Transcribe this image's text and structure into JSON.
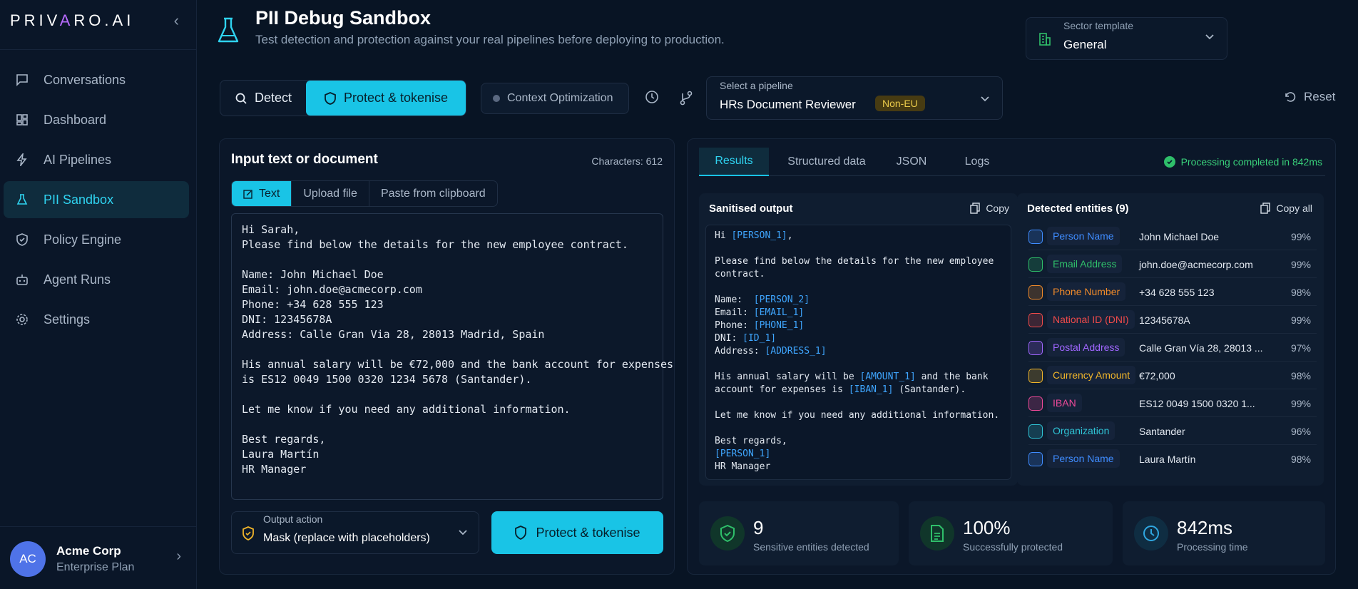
{
  "app": {
    "logo_left": "PRIV",
    "logo_a": "A",
    "logo_right": "RO.AI"
  },
  "sidebar": {
    "items": [
      {
        "label": "Conversations",
        "icon": "chat-icon"
      },
      {
        "label": "Dashboard",
        "icon": "dashboard-icon"
      },
      {
        "label": "AI Pipelines",
        "icon": "bolt-icon"
      },
      {
        "label": "PII Sandbox",
        "icon": "flask-icon",
        "active": true
      },
      {
        "label": "Policy Engine",
        "icon": "shield-icon"
      },
      {
        "label": "Agent Runs",
        "icon": "robot-icon"
      },
      {
        "label": "Settings",
        "icon": "gear-icon"
      }
    ],
    "account": {
      "initials": "AC",
      "name": "Acme Corp",
      "plan": "Enterprise Plan"
    }
  },
  "header": {
    "title": "PII Debug Sandbox",
    "subtitle": "Test detection and protection against your real pipelines before deploying to production.",
    "sector_label": "Sector template",
    "sector_value": "General"
  },
  "toolbar": {
    "detect_label": "Detect",
    "protect_label": "Protect & tokenise",
    "context_label": "Context Optimization",
    "pipeline_label": "Select a pipeline",
    "pipeline_value": "HRs Document Reviewer",
    "pipeline_tag": "Non-EU",
    "reset_label": "Reset"
  },
  "input": {
    "title": "Input text or document",
    "characters": "Characters: 612",
    "tabs": [
      "Text",
      "Upload file",
      "Paste from clipboard"
    ],
    "text": "Hi Sarah,\nPlease find below the details for the new employee contract.\n\nName: John Michael Doe\nEmail: john.doe@acmecorp.com\nPhone: +34 628 555 123\nDNI: 12345678A\nAddress: Calle Gran Via 28, 28013 Madrid, Spain\n\nHis annual salary will be €72,000 and the bank account for expenses\nis ES12 0049 1500 0320 1234 5678 (Santander).\n\nLet me know if you need any additional information.\n\nBest regards,\nLaura Martín\nHR Manager",
    "output_action_label": "Output action",
    "output_action_value": "Mask (replace with placeholders)",
    "protect_button": "Protect & tokenise"
  },
  "results": {
    "tabs": [
      "Results",
      "Structured data",
      "JSON",
      "Logs"
    ],
    "status": "Processing completed in 842ms",
    "sanitised_title": "Sanitised output",
    "copy_label": "Copy",
    "copy_all_label": "Copy all",
    "entities_title": "Detected entities (9)",
    "entities": [
      {
        "type": "Person Name",
        "value": "John Michael Doe",
        "confidence": "99%",
        "color": "#3f8cff"
      },
      {
        "type": "Email Address",
        "value": "john.doe@acmecorp.com",
        "confidence": "99%",
        "color": "#2fbf6a"
      },
      {
        "type": "Phone Number",
        "value": "+34 628 555 123",
        "confidence": "98%",
        "color": "#f08a2a"
      },
      {
        "type": "National ID (DNI)",
        "value": "12345678A",
        "confidence": "99%",
        "color": "#ef4a4a"
      },
      {
        "type": "Postal Address",
        "value": "Calle Gran Vía 28, 28013 ...",
        "confidence": "97%",
        "color": "#a066ff"
      },
      {
        "type": "Currency Amount",
        "value": "€72,000",
        "confidence": "98%",
        "color": "#f0b52a"
      },
      {
        "type": "IBAN",
        "value": "ES12 0049 1500 0320 1...",
        "confidence": "99%",
        "color": "#f04a9a"
      },
      {
        "type": "Organization",
        "value": "Santander",
        "confidence": "96%",
        "color": "#2fc4d6"
      },
      {
        "type": "Person Name",
        "value": "Laura Martín",
        "confidence": "98%",
        "color": "#3f8cff"
      }
    ],
    "stats": [
      {
        "value": "9",
        "label": "Sensitive entities detected",
        "color": "#2fbf6a"
      },
      {
        "value": "100%",
        "label": "Successfully protected",
        "color": "#2fbf6a"
      },
      {
        "value": "842ms",
        "label": "Processing time",
        "color": "#2fa6e0"
      }
    ]
  },
  "sanitised": [
    [
      [
        "Hi ",
        ""
      ],
      [
        "[PERSON_1]",
        "ph"
      ],
      [
        ",",
        ""
      ]
    ],
    [
      [
        "",
        ""
      ]
    ],
    [
      [
        "Please find below the details for the new employee",
        ""
      ]
    ],
    [
      [
        "contract.",
        ""
      ]
    ],
    [
      [
        "",
        ""
      ]
    ],
    [
      [
        "Name:  ",
        ""
      ],
      [
        "[PERSON_2]",
        "ph"
      ]
    ],
    [
      [
        "Email: ",
        ""
      ],
      [
        "[EMAIL_1]",
        "ph"
      ]
    ],
    [
      [
        "Phone: ",
        ""
      ],
      [
        "[PHONE_1]",
        "ph"
      ]
    ],
    [
      [
        "DNI: ",
        ""
      ],
      [
        "[ID_1]",
        "ph"
      ]
    ],
    [
      [
        "Address: ",
        ""
      ],
      [
        "[ADDRESS_1]",
        "ph"
      ]
    ],
    [
      [
        "",
        ""
      ]
    ],
    [
      [
        "His annual salary will be ",
        ""
      ],
      [
        "[AMOUNT_1]",
        "ph"
      ],
      [
        " and the bank",
        ""
      ]
    ],
    [
      [
        "account for expenses is ",
        ""
      ],
      [
        "[IBAN_1]",
        "ph"
      ],
      [
        " (Santander).",
        ""
      ]
    ],
    [
      [
        "",
        ""
      ]
    ],
    [
      [
        "Let me know if you need any additional information.",
        ""
      ]
    ],
    [
      [
        "",
        ""
      ]
    ],
    [
      [
        "Best regards,",
        ""
      ]
    ],
    [
      [
        "[PERSON_1]",
        "ph"
      ]
    ],
    [
      [
        "HR Manager",
        ""
      ]
    ]
  ]
}
